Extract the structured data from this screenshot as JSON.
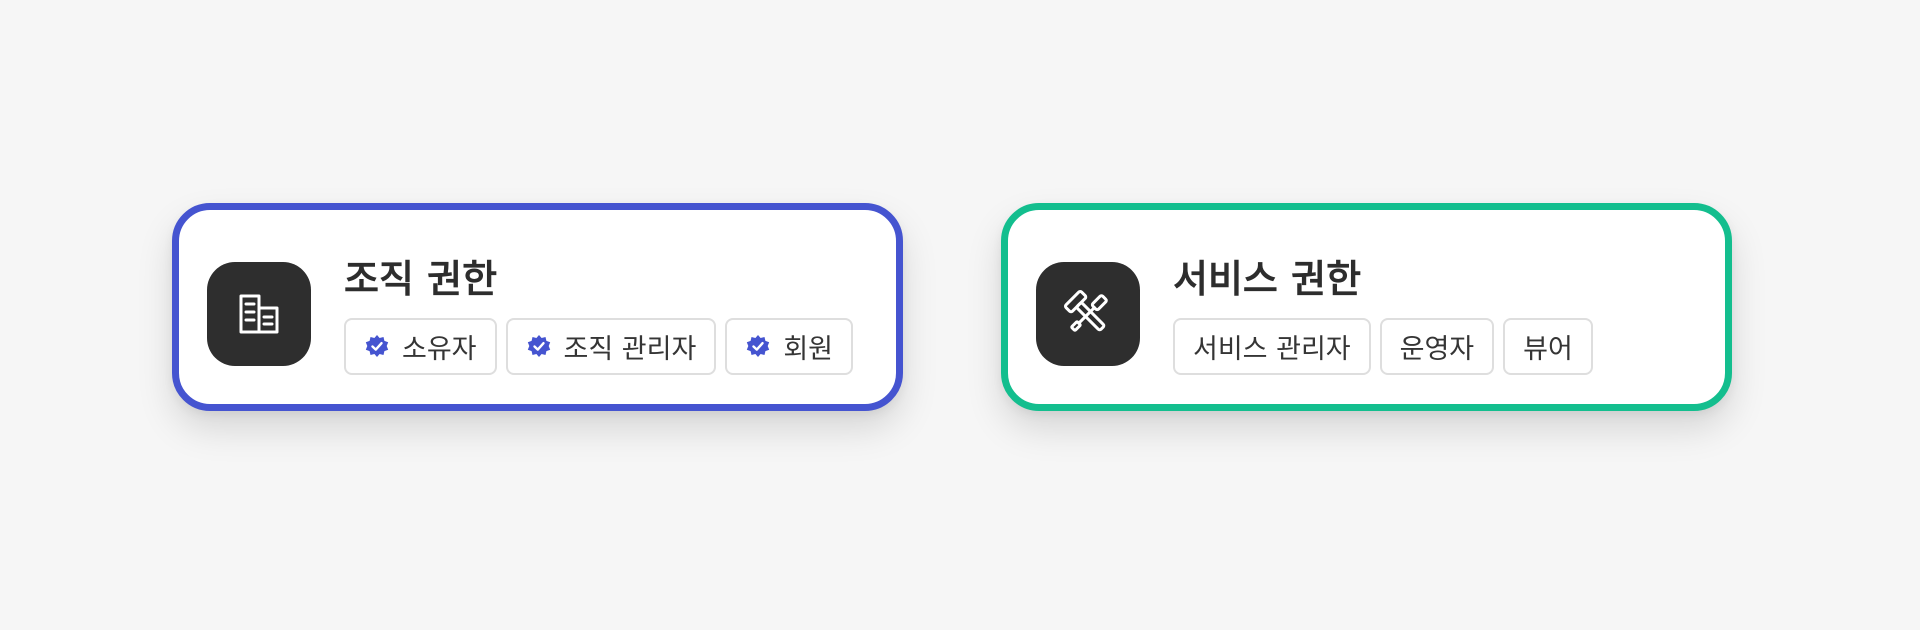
{
  "colors": {
    "background": "#f6f6f6",
    "org_border": "#4554d0",
    "service_border": "#13be8e",
    "icon_tile": "#2e2e2e",
    "check_badge": "#4554d0"
  },
  "org_card": {
    "icon": "building-icon",
    "title": "조직 권한",
    "chips": [
      {
        "label": "소유자",
        "icon": "verified-check-icon"
      },
      {
        "label": "조직 관리자",
        "icon": "verified-check-icon"
      },
      {
        "label": "회원",
        "icon": "verified-check-icon"
      }
    ]
  },
  "service_card": {
    "icon": "tools-icon",
    "title": "서비스 권한",
    "chips": [
      {
        "label": "서비스 관리자"
      },
      {
        "label": "운영자"
      },
      {
        "label": "뷰어"
      }
    ]
  }
}
